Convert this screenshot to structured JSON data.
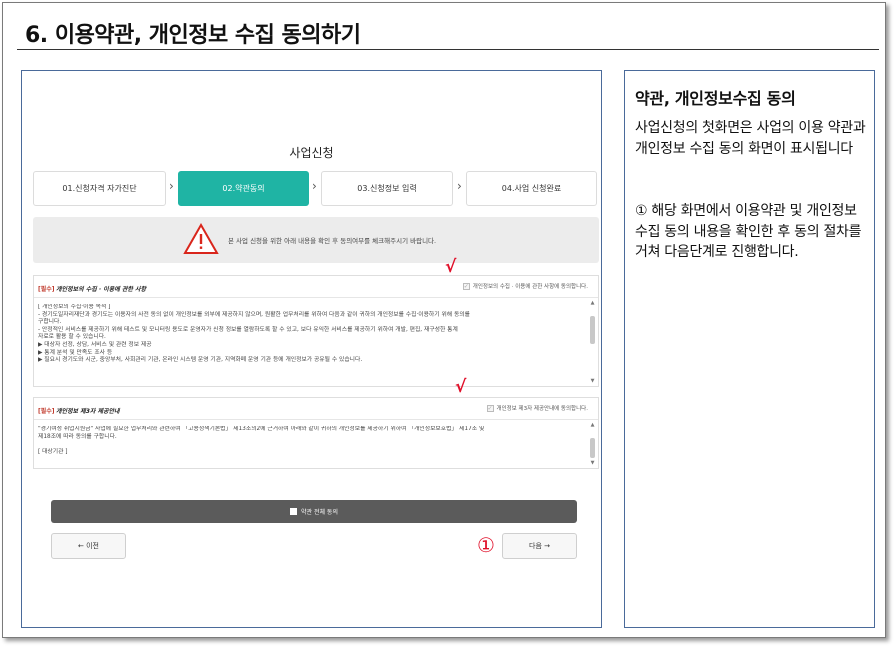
{
  "page": {
    "title": "6. 이용약관, 개인정보 수집 동의하기"
  },
  "screenshot": {
    "title": "사업신청",
    "steps": [
      {
        "label": "01.신청자격 자가진단",
        "active": false
      },
      {
        "label": "02.약관동의",
        "active": true
      },
      {
        "label": "03.신청정보 입력",
        "active": false
      },
      {
        "label": "04.사업 신청완료",
        "active": false
      }
    ],
    "notice": "본 사업 신청을 위한 아래 내용을 확인 후 동의여부를 체크해주시기 바랍니다.",
    "section1": {
      "required": "[필수]",
      "title": "개인정보의 수집 · 이용에 관한 사항",
      "checkbox_label": "개인정보의 수집 · 이용에 관한 사항에 동의합니다.",
      "lines": [
        "[ 개인정보의 수집·이용 목적 ]",
        "- 경기도일자리재단과 경기도는 이용자의 사전 동의 없이 개인정보를 외부에 제공하지 않으며, 원활한 업무처리를 위하여 다음과 같이 귀하의 개인정보를 수집·이용하기 위해 동의를",
        "구합니다.",
        "- 안정적인 서비스를 제공하기 위해 테스트 및 모니터링 용도로 운영자가 신청 정보를 열람하도록 할 수 있고, 보다 유익한 서비스를 제공하기 위하여 개발, 편집, 재구성한 통계",
        "자료로 활용 할 수 있습니다.",
        "   ▶ 대상자 선정, 상담, 서비스 및 관련 정보 제공",
        "   ▶ 통계 분석 및 만족도 조사 등",
        "   ▶ 필요시 경기도와 시군, 중앙부처, 사회관리 기관, 온라인 시스템 운영 기관, 지역화폐 운영 기관 등에 개인정보가 공유될 수 있습니다."
      ]
    },
    "section2": {
      "required": "[필수]",
      "title": "개인정보 제3자 제공안내",
      "checkbox_label": "개인정보 제3자 제공안내에 동의합니다.",
      "lines": [
        "\"경기여성 취업지원금\" 사업에 필요한 업무처리와 관련하여 「고용정책기본법」 제13조의2에 근거하여 아래와 같이 귀하의 개인정보를 제공하기 위하여 「개인정보보호법」 제17조 및",
        "제18조에 따라 동의를 구합니다.",
        "",
        "[ 대상기관 ]"
      ]
    },
    "check_marks": [
      "√",
      "√"
    ],
    "agree_all": "약관 전체 동의",
    "prev_button": "← 이전",
    "next_button": "다음 →",
    "marker": "①"
  },
  "description": {
    "title": "약관, 개인정보수집 동의",
    "paragraph1": "사업신청의 첫화면은 사업의 이용 약관과 개인정보 수집 동의 화면이 표시됩니다",
    "paragraph2": "① 해당 화면에서 이용약관 및 개인정보수집 동의 내용을 확인한 후 동의 절차를 거쳐 다음단계로 진행합니다."
  },
  "colors": {
    "accent": "#1fb4a4",
    "marker_red": "#e0102a",
    "panel_border": "#4a6a9a"
  }
}
